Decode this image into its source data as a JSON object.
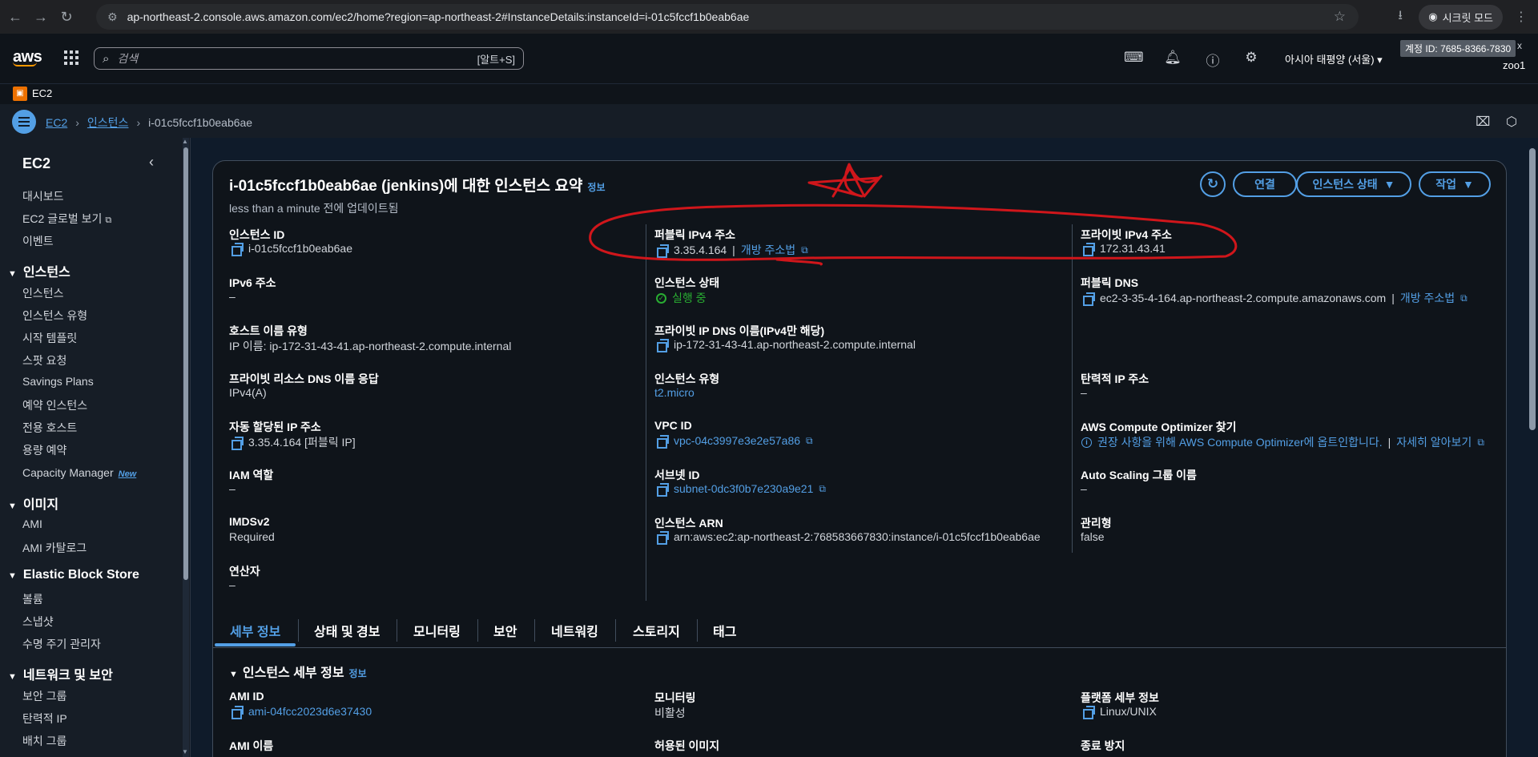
{
  "browser": {
    "url": "ap-northeast-2.console.aws.amazon.com/ec2/home?region=ap-northeast-2#InstanceDetails:instanceId=i-01c5fccf1b0eab6ae",
    "incognito_label": "시크릿 모드"
  },
  "header": {
    "search_placeholder": "검색",
    "search_shortcut": "[알트+S]",
    "region": "아시아 태평양 (서울)",
    "account": "계정 ID: 7685-8366-7830",
    "account_close": "x",
    "user": "zoo1",
    "service_name": "EC2"
  },
  "breadcrumb": {
    "items": [
      "EC2",
      "인스턴스"
    ],
    "current": "i-01c5fccf1b0eab6ae"
  },
  "sidebar": {
    "title": "EC2",
    "top_items": [
      "대시보드",
      "EC2 글로벌 보기",
      "이벤트"
    ],
    "sections": [
      {
        "title": "인스턴스",
        "items": [
          "인스턴스",
          "인스턴스 유형",
          "시작 템플릿",
          "스팟 요청",
          "Savings Plans",
          "예약 인스턴스",
          "전용 호스트",
          "용량 예약",
          "Capacity Manager"
        ]
      },
      {
        "title": "이미지",
        "items": [
          "AMI",
          "AMI 카탈로그"
        ]
      },
      {
        "title": "Elastic Block Store",
        "items": [
          "볼륨",
          "스냅샷",
          "수명 주기 관리자"
        ]
      },
      {
        "title": "네트워크 및 보안",
        "items": [
          "보안 그룹",
          "탄력적 IP",
          "배치 그룹"
        ]
      }
    ],
    "new_badge": "New"
  },
  "summary": {
    "title": "i-01c5fccf1b0eab6ae (jenkins)에 대한 인스턴스 요약",
    "info": "정보",
    "updated": "less than a minute 전에 업데이트됨",
    "buttons": {
      "connect": "연결",
      "instance_state": "인스턴스 상태",
      "actions": "작업"
    },
    "col1": [
      {
        "label": "인스턴스 ID",
        "value": "i-01c5fccf1b0eab6ae"
      },
      {
        "label": "IPv6 주소",
        "value": "–"
      },
      {
        "label": "호스트 이름 유형",
        "value": "IP 이름: ip-172-31-43-41.ap-northeast-2.compute.internal"
      },
      {
        "label": "프라이빗 리소스 DNS 이름 응답",
        "value": "IPv4(A)"
      },
      {
        "label": "자동 할당된 IP 주소",
        "value": "3.35.4.164 [퍼블릭 IP]"
      },
      {
        "label": "IAM 역할",
        "value": "–"
      },
      {
        "label": "IMDSv2",
        "value": "Required"
      },
      {
        "label": "연산자",
        "value": "–"
      }
    ],
    "col2": [
      {
        "label": "퍼블릭 IPv4 주소",
        "value": "3.35.4.164",
        "link": "개방 주소법"
      },
      {
        "label": "인스턴스 상태",
        "value": "실행 중"
      },
      {
        "label": "프라이빗 IP DNS 이름(IPv4만 해당)",
        "value": "ip-172-31-43-41.ap-northeast-2.compute.internal"
      },
      {
        "label": "인스턴스 유형",
        "value": "t2.micro"
      },
      {
        "label": "VPC ID",
        "value": "vpc-04c3997e3e2e57a86"
      },
      {
        "label": "서브넷 ID",
        "value": "subnet-0dc3f0b7e230a9e21"
      },
      {
        "label": "인스턴스 ARN",
        "value": "arn:aws:ec2:ap-northeast-2:768583667830:instance/i-01c5fccf1b0eab6ae"
      }
    ],
    "col3": [
      {
        "label": "프라이빗 IPv4 주소",
        "value": "172.31.43.41"
      },
      {
        "label": "퍼블릭 DNS",
        "value": "ec2-3-35-4-164.ap-northeast-2.compute.amazonaws.com",
        "link": "개방 주소법"
      },
      {
        "label": "탄력적 IP 주소",
        "value": "–"
      },
      {
        "label": "AWS Compute Optimizer 찾기",
        "value": "권장 사항을 위해 AWS Compute Optimizer에 옵트인합니다.",
        "link": "자세히 알아보기"
      },
      {
        "label": "Auto Scaling 그룹 이름",
        "value": "–"
      },
      {
        "label": "관리형",
        "value": "false"
      }
    ]
  },
  "tabs": [
    "세부 정보",
    "상태 및 경보",
    "모니터링",
    "보안",
    "네트워킹",
    "스토리지",
    "태그"
  ],
  "details": {
    "title": "인스턴스 세부 정보",
    "info": "정보",
    "col1": [
      {
        "label": "AMI ID",
        "value": "ami-04fcc2023d6e37430"
      },
      {
        "label": "AMI 이름",
        "value": ""
      }
    ],
    "col2": [
      {
        "label": "모니터링",
        "value": "비활성"
      },
      {
        "label": "허용된 이미지",
        "value": ""
      }
    ],
    "col3": [
      {
        "label": "플랫폼 세부 정보",
        "value": "Linux/UNIX"
      },
      {
        "label": "종료 방지",
        "value": ""
      }
    ]
  },
  "colors": {
    "accent": "#539fe5",
    "success": "#29ad32",
    "annotation": "#d0161b"
  }
}
